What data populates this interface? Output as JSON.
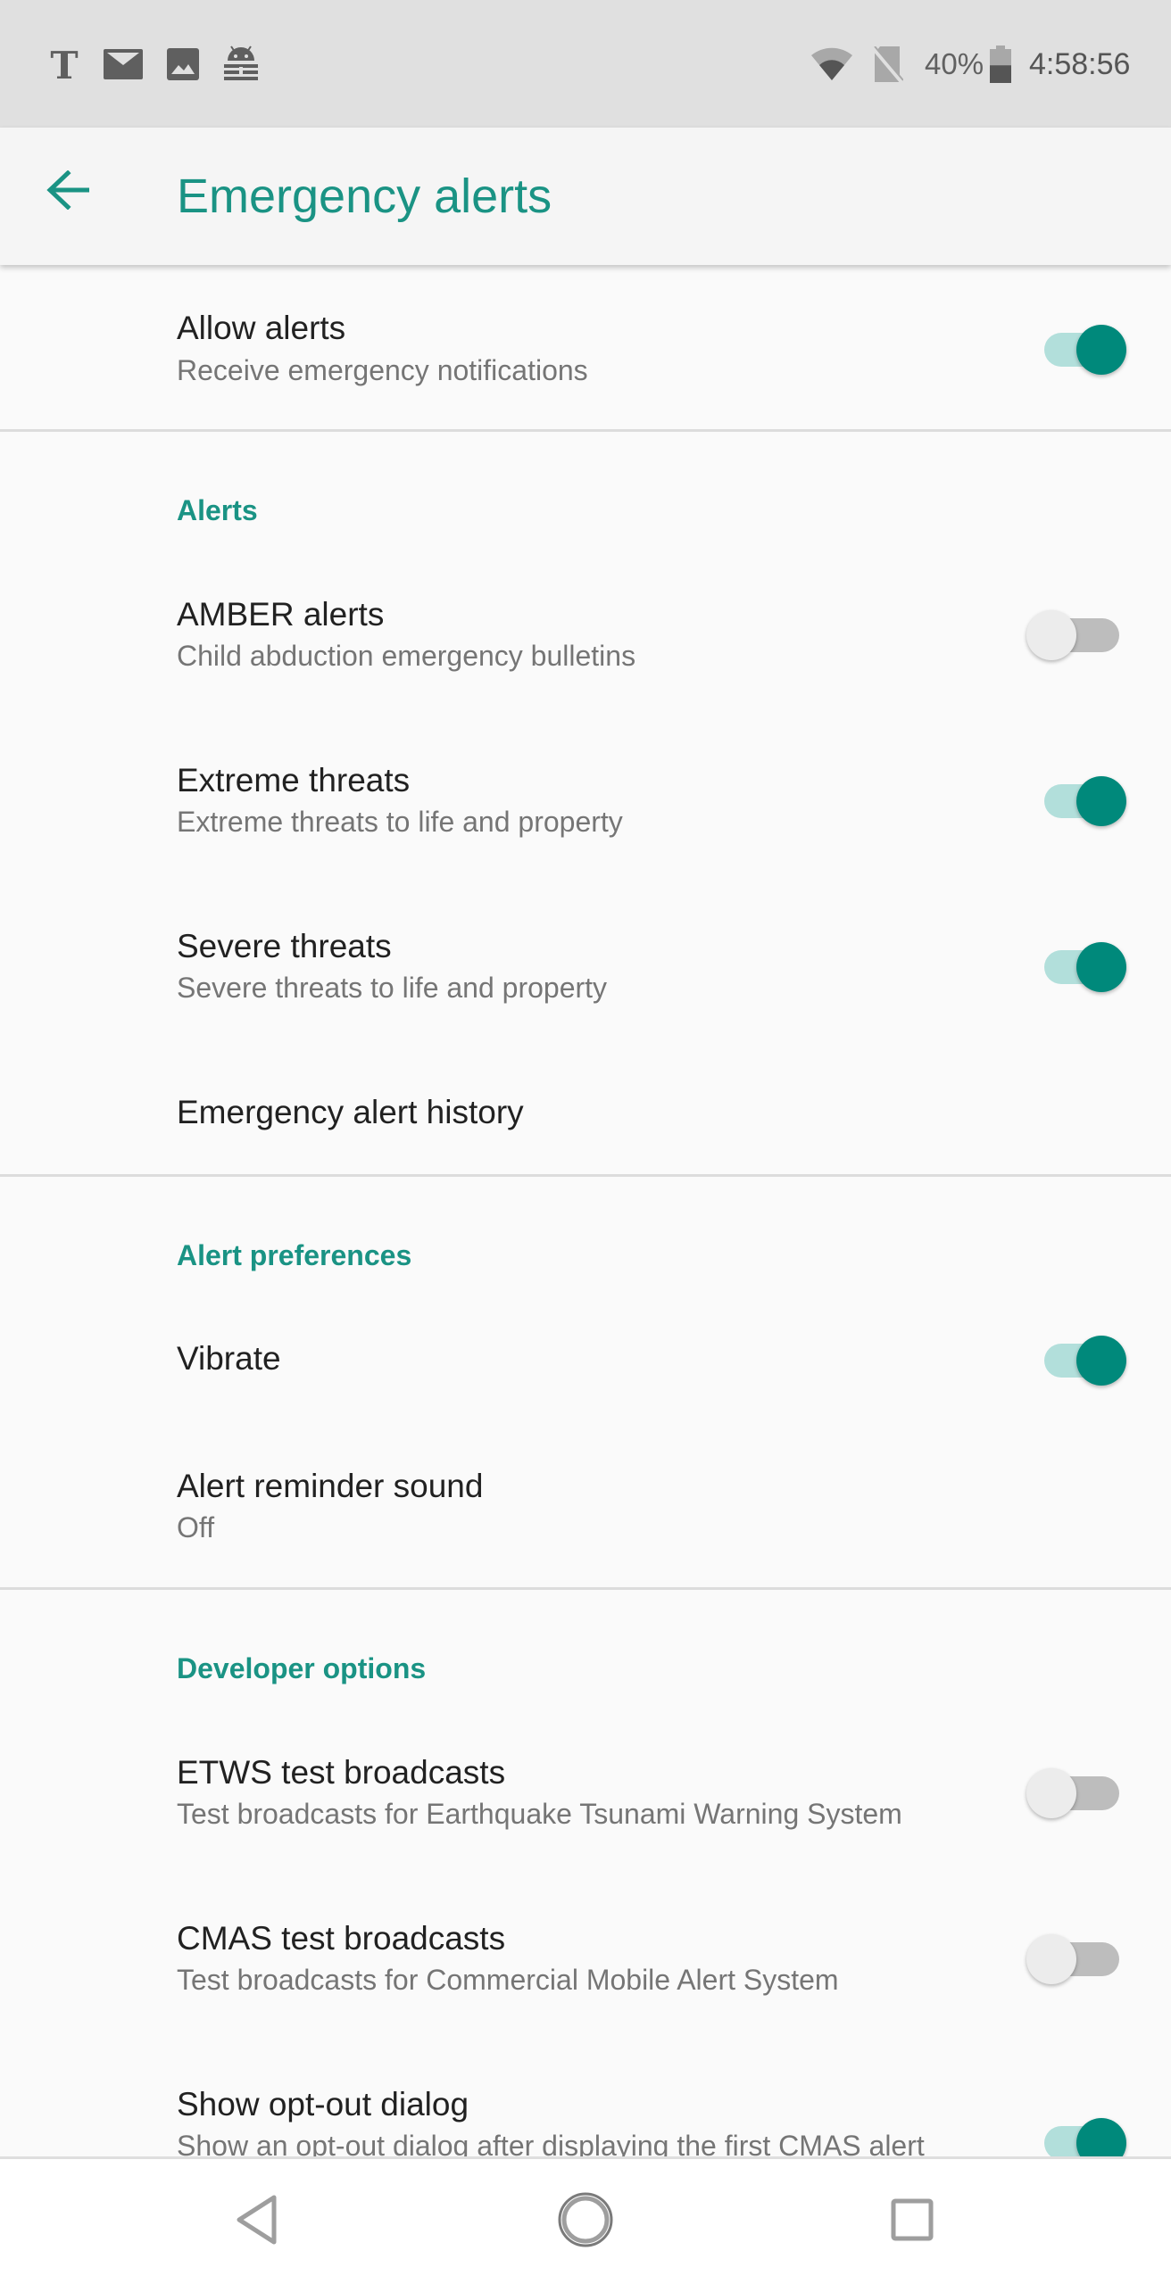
{
  "status_bar": {
    "notification_icons": [
      "nytimes-icon",
      "email-icon",
      "image-icon",
      "android-keepass-icon"
    ],
    "system_icons": [
      "wifi-icon",
      "no-sim-icon"
    ],
    "battery_percent": "40%",
    "battery_level": 0.4,
    "clock": "4:58:56"
  },
  "app_bar": {
    "back_icon": "arrow-left-icon",
    "title": "Emergency alerts"
  },
  "colors": {
    "accent": "#00897b",
    "accent_text": "#1a9384",
    "track_on": "#b2dfdb",
    "track_off": "#bdbdbd"
  },
  "preferences": {
    "allow_alerts": {
      "title": "Allow alerts",
      "summary": "Receive emergency notifications",
      "enabled": true
    },
    "alerts_category": "Alerts",
    "amber": {
      "title": "AMBER alerts",
      "summary": "Child abduction emergency bulletins",
      "enabled": false
    },
    "extreme": {
      "title": "Extreme threats",
      "summary": "Extreme threats to life and property",
      "enabled": true
    },
    "severe": {
      "title": "Severe threats",
      "summary": "Severe threats to life and property",
      "enabled": true
    },
    "history": {
      "title": "Emergency alert history"
    },
    "preferences_category": "Alert preferences",
    "vibrate": {
      "title": "Vibrate",
      "enabled": true
    },
    "reminder_sound": {
      "title": "Alert reminder sound",
      "summary": "Off"
    },
    "developer_category": "Developer options",
    "etws": {
      "title": "ETWS test broadcasts",
      "summary": "Test broadcasts for Earthquake Tsunami Warning System",
      "enabled": false
    },
    "cmas": {
      "title": "CMAS test broadcasts",
      "summary": "Test broadcasts for Commercial Mobile Alert System",
      "enabled": false
    },
    "opt_out": {
      "title": "Show opt-out dialog",
      "summary": "Show an opt-out dialog after displaying the first CMAS alert",
      "enabled": true
    }
  },
  "nav_bar": {
    "back": "nav-back-icon",
    "home": "nav-home-icon",
    "recents": "nav-recents-icon"
  }
}
